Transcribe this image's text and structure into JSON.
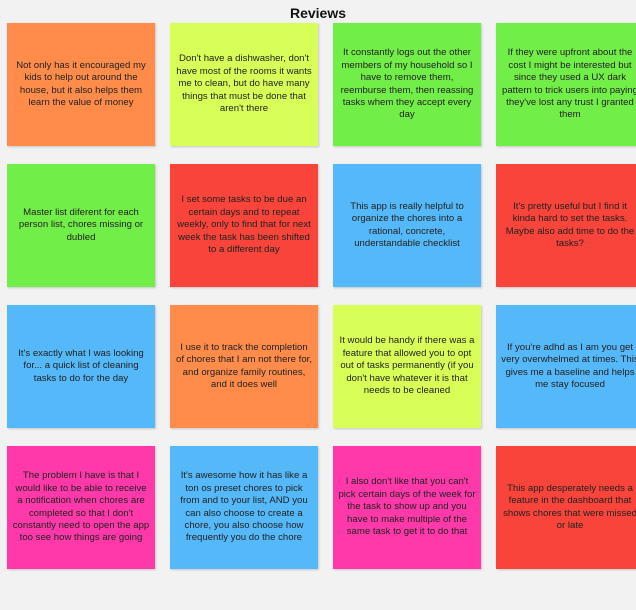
{
  "title": "Reviews",
  "colors": {
    "orange": "#ff8c4a",
    "yellow": "#d8ff58",
    "green": "#72ee48",
    "red": "#f8443a",
    "blue": "#55b8f8",
    "pink": "#ff39aa"
  },
  "notes": [
    {
      "text": "Not only has it encouraged my kids to help out around the house, but it also helps them learn the value of money",
      "color": "orange"
    },
    {
      "text": "Don't have a dishwasher, don't have most of the rooms it wants me to clean, but do have many things that must be done that aren't there",
      "color": "yellow"
    },
    {
      "text": "It constantly logs out the other members of my household so I have to remove them, reemburse them, then reassing tasks whem they accept every day",
      "color": "green"
    },
    {
      "text": "If they were upfront about the cost I might be interested but since they used a UX dark pattern to trick users into paying they've lost any trust I granted them",
      "color": "green"
    },
    {
      "text": "Master list diferent for each person list, chores missing or dubled",
      "color": "green"
    },
    {
      "text": "I set some tasks to be due an certain days and to repeat weekly, only to find that for next week the task has been shifted to a different day",
      "color": "red"
    },
    {
      "text": "This app is really helpful to organize the chores into a rational, concrete, understandable checklist",
      "color": "blue"
    },
    {
      "text": "It's pretty useful but I find it kinda hard to set the tasks. Maybe also add time to do the tasks?",
      "color": "red"
    },
    {
      "text": "It's exactly what I was looking for... a quick list of cleaning tasks to do for the day",
      "color": "blue"
    },
    {
      "text": "I use it to track the completion of chores that I am not there for, and organize family routines, and it does well",
      "color": "orange"
    },
    {
      "text": "It would be handy if there was a feature that allowed you to opt out of tasks permanently (if you don't have whatever it is that needs to be cleaned",
      "color": "yellow"
    },
    {
      "text": "If you're adhd as I am you get very overwhelmed at times. This gives me a baseline and helps me stay focused",
      "color": "blue"
    },
    {
      "text": "The problem I have is that I would like to be able to receive a notification when chores are completed so that I don't constantly need to open the app too see how things are going",
      "color": "pink"
    },
    {
      "text": "It's awesome how it has like a ton os preset chores to pick from and to your list, AND you can also choose to create a chore, you also choose how frequently you do the chore",
      "color": "blue"
    },
    {
      "text": "I also don't like that you can't pick certain days of the week for the task to show up and you have to make multiple of the same task to get it to do that",
      "color": "pink"
    },
    {
      "text": "This app desperately needs a feature in the dashboard that shows chores that were missed or late",
      "color": "red"
    }
  ]
}
